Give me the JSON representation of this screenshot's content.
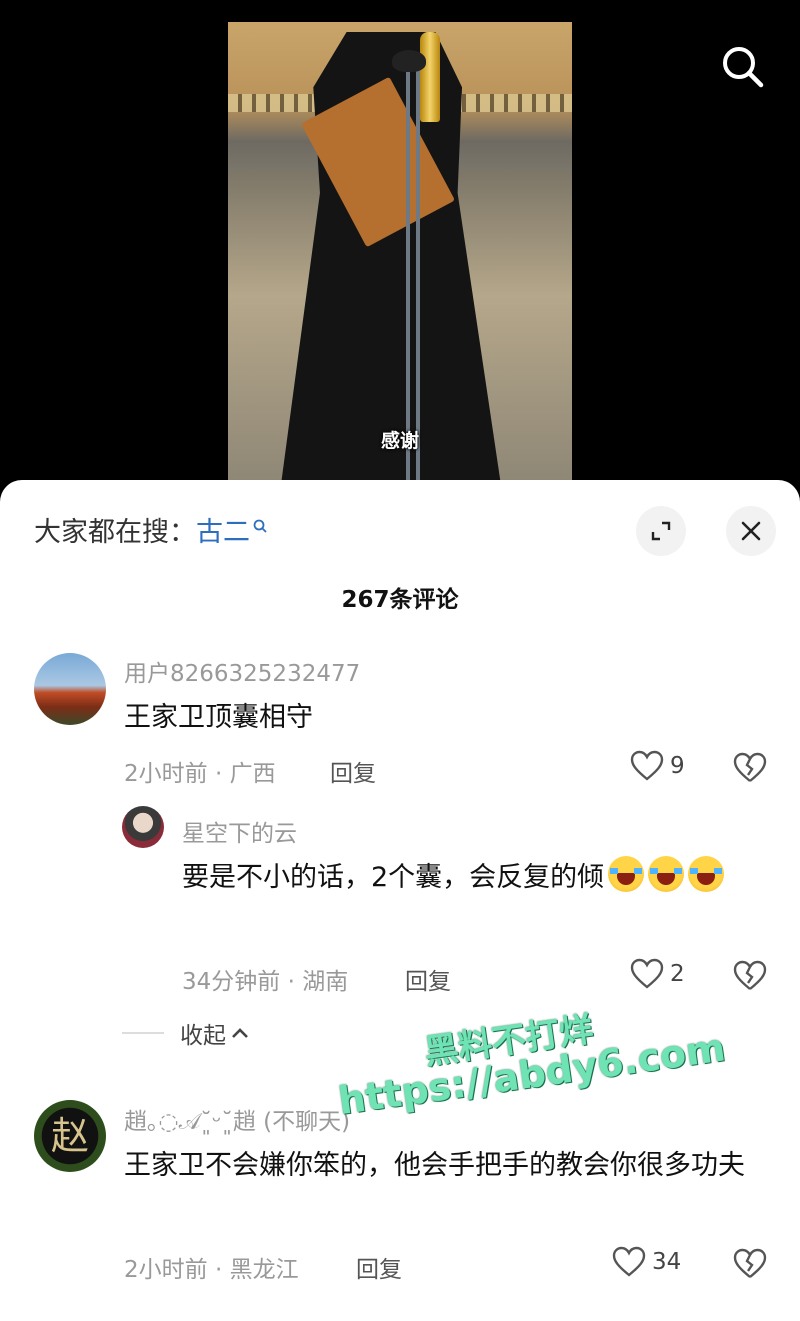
{
  "video": {
    "subtitle": "感谢"
  },
  "sheet": {
    "hot_search_label": "大家都在搜：",
    "hot_search_term": "古二",
    "comment_count": "267条评论",
    "collapse_label": "收起"
  },
  "comments": [
    {
      "username": "用户8266325232477",
      "text": "王家卫顶囊相守",
      "time_location": "2小时前 · 广西",
      "reply_label": "回复",
      "likes": "9"
    },
    {
      "username": "星空下的云",
      "text": "要是不小的话，2个囊，会反复的倾",
      "emoji": "loudly-crying-face",
      "time_location": "34分钟前 · 湖南",
      "reply_label": "回复",
      "likes": "2"
    },
    {
      "username": "趙｡◌𝒜˘͈ᵕ˘͈趙 (不聊天)",
      "avatar_glyph": "赵",
      "text": "王家卫不会嫌你笨的，他会手把手的教会你很多功夫",
      "time_location": "2小时前 · 黑龙江",
      "reply_label": "回复",
      "likes": "34"
    }
  ],
  "watermark": {
    "line1": "黑料不打烊",
    "line2": "https://abdy6.com"
  },
  "colors": {
    "accent_link": "#2e6fbd",
    "sheet_bg": "#ffffff",
    "muted_text": "#999999",
    "watermark": "#6fe3b3"
  },
  "icons": [
    "search-icon",
    "mini-search-icon",
    "expand-icon",
    "close-icon",
    "heart-icon",
    "broken-heart-icon",
    "chevron-up-icon"
  ]
}
